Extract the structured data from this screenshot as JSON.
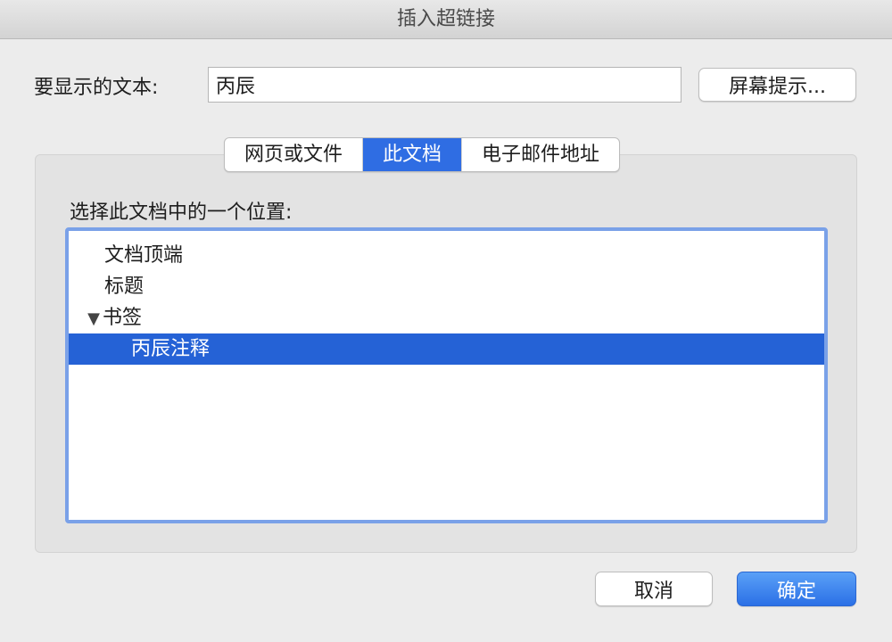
{
  "window": {
    "title": "插入超链接"
  },
  "display_text": {
    "label": "要显示的文本:",
    "value": "丙辰"
  },
  "screentip_button": "屏幕提示...",
  "tabs": [
    {
      "label": "网页或文件",
      "active": false
    },
    {
      "label": "此文档",
      "active": true
    },
    {
      "label": "电子邮件地址",
      "active": false
    }
  ],
  "location": {
    "label": "选择此文档中的一个位置:",
    "items": [
      {
        "label": "文档顶端",
        "expanded": null,
        "selected": false
      },
      {
        "label": "标题",
        "expanded": null,
        "selected": false
      },
      {
        "label": "书签",
        "expanded": true,
        "selected": false
      },
      {
        "label": "丙辰注释",
        "expanded": null,
        "selected": true
      }
    ]
  },
  "buttons": {
    "cancel": "取消",
    "ok": "确定"
  },
  "colors": {
    "accent": "#2f6de3",
    "selection": "#2562d6",
    "focus_ring": "#7aa1e8"
  }
}
